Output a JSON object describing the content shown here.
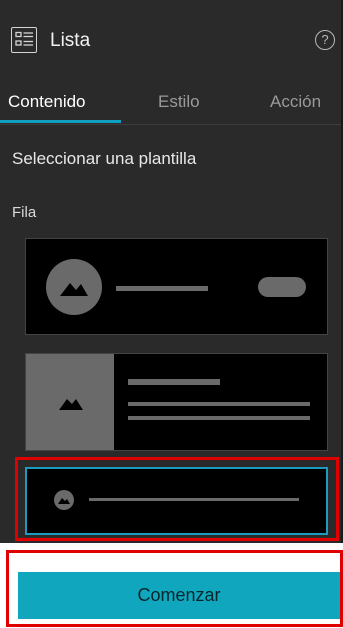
{
  "header": {
    "title": "Lista",
    "help_symbol": "?"
  },
  "tabs": [
    {
      "label": "Contenido",
      "active": true
    },
    {
      "label": "Estilo",
      "active": false
    },
    {
      "label": "Acción",
      "active": false
    }
  ],
  "content": {
    "section_title": "Seleccionar una plantilla",
    "subsection": "Fila",
    "templates": [
      {
        "name": "row-template-1",
        "selected": false
      },
      {
        "name": "row-template-2",
        "selected": false
      },
      {
        "name": "row-template-3",
        "selected": true
      }
    ]
  },
  "footer": {
    "start_button": "Comenzar"
  },
  "colors": {
    "accent": "#10a6bd",
    "panel_bg": "#2a2a2a",
    "highlight": "#e00000"
  }
}
